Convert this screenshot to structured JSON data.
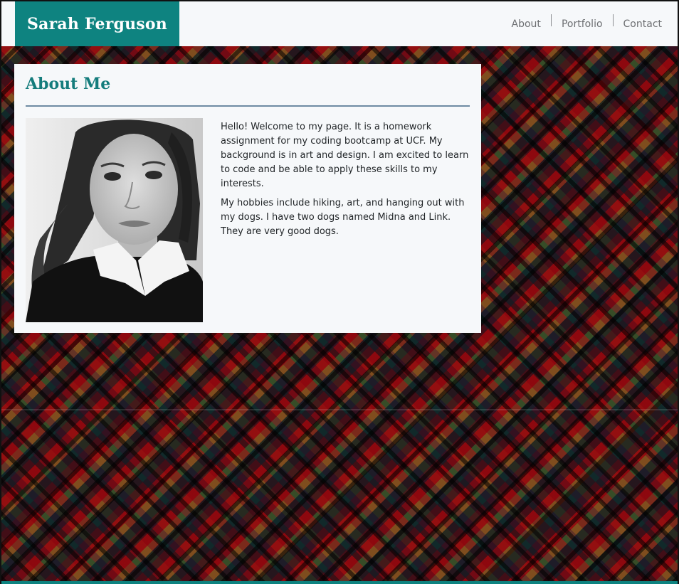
{
  "header": {
    "brand": "Sarah Ferguson",
    "nav": [
      {
        "label": "About"
      },
      {
        "label": "Portfolio"
      },
      {
        "label": "Contact"
      }
    ]
  },
  "about": {
    "title": "About Me",
    "portrait_alt": "portrait photo",
    "paragraphs": [
      "Hello! Welcome to my page. It is a homework assignment for my coding bootcamp at UCF. My background is in art and design. I am excited to learn to code and be able to apply these skills to my interests.",
      "My hobbies include hiking, art, and hanging out with my dogs. I have two dogs named Midna and Link. They are very good dogs."
    ]
  },
  "colors": {
    "brand": "#0e8380",
    "title": "#147c7c",
    "card": "#f6f8fa",
    "rule": "#6e8ba3"
  }
}
